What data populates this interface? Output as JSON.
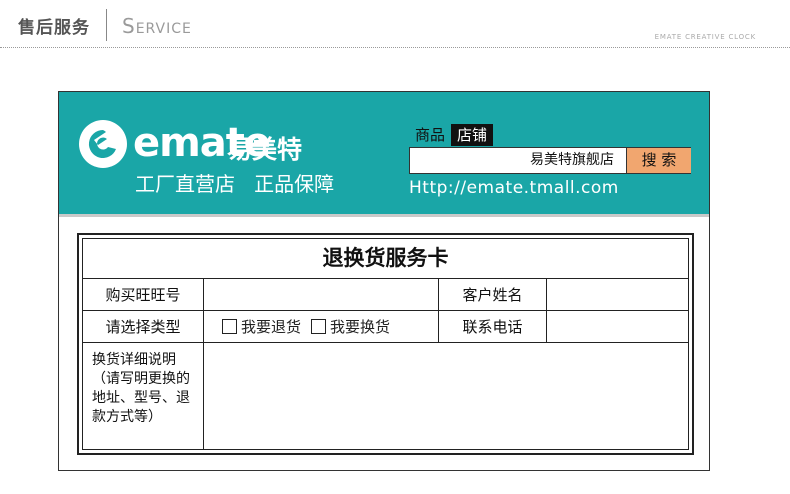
{
  "header": {
    "title_cn": "售后服务",
    "title_en": "Service",
    "subtitle": "EMATE CREATIVE CLOCK"
  },
  "banner": {
    "brand_name": "emate",
    "brand_cn": "易美特",
    "slogan": "工厂直营店   正品保障",
    "tabs": [
      "商品",
      "店铺"
    ],
    "active_tab": "店铺",
    "search_value": "易美特旗舰店",
    "search_button": "搜 索",
    "url": "Http://emate.tmall.com",
    "colors": {
      "banner": "#1aa6a7",
      "search_button": "#f1a66f"
    }
  },
  "form": {
    "title": "退换货服务卡",
    "wangwang_label": "购买旺旺号",
    "wangwang_value": "",
    "customer_label": "客户姓名",
    "customer_value": "",
    "type_label": "请选择类型",
    "option_return": "我要退货",
    "option_exchange": "我要换货",
    "phone_label": "联系电话",
    "phone_value": "",
    "desc_label": "换货详细说明（请写明更换的地址、型号、退款方式等）",
    "desc_value": ""
  }
}
